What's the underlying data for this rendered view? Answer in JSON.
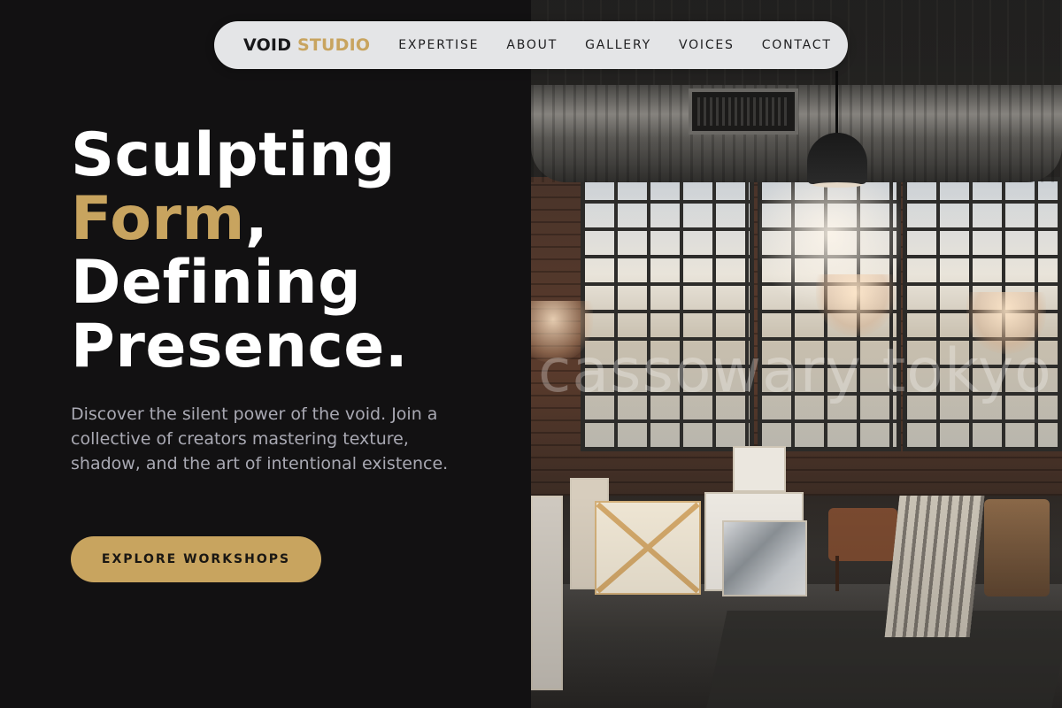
{
  "nav": {
    "brand_primary": "VOID",
    "brand_accent": "STUDIO",
    "links": [
      {
        "label": "EXPERTISE"
      },
      {
        "label": "ABOUT"
      },
      {
        "label": "GALLERY"
      },
      {
        "label": "VOICES"
      },
      {
        "label": "CONTACT"
      }
    ]
  },
  "hero": {
    "headline": {
      "line1": "Sculpting",
      "line2_accent": "Form",
      "line2_rest": ",",
      "line3": "Defining",
      "line4": "Presence."
    },
    "lead": "Discover the silent power of the void. Join a collective of creators mastering texture, shadow, and the art of intentional existence.",
    "cta_label": "EXPLORE WORKSHOPS",
    "image_watermark": "cassowary tokyo"
  },
  "colors": {
    "background": "#121112",
    "accent_gold": "#c8a45f",
    "nav_background": "#e4e5e7",
    "body_text": "#a9a9b3"
  },
  "icons": {}
}
